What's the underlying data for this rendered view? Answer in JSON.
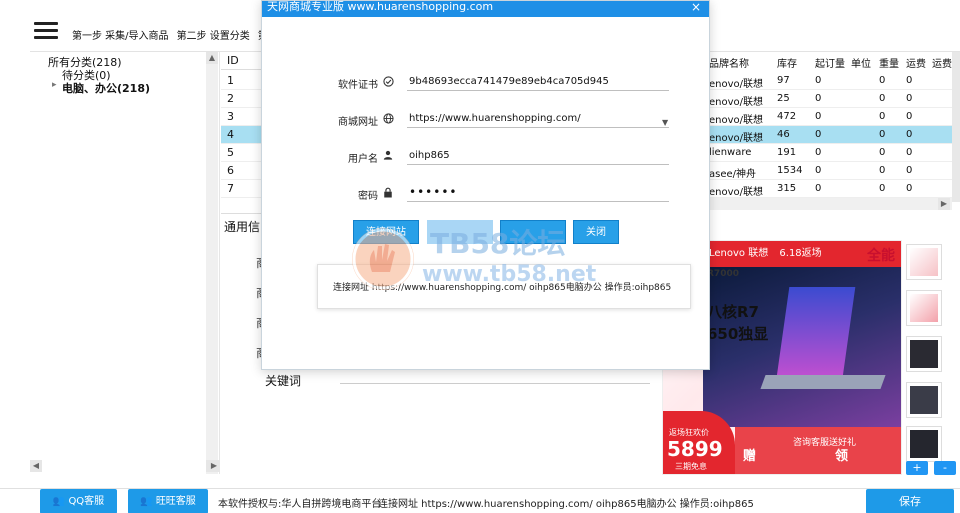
{
  "toolbar": {
    "steps": [
      "第一步 采集/导入商品",
      "第二步 设置分类",
      "第"
    ]
  },
  "tree": {
    "all": "所有分类(218)",
    "pending": "待分类(0)",
    "computers": "电脑、办公(218)"
  },
  "grid": {
    "id_header": "ID",
    "ids": [
      "1",
      "2",
      "3",
      "4",
      "5",
      "6",
      "7"
    ],
    "selected_index": 3,
    "headers": [
      "品牌名称",
      "库存",
      "起订量",
      "单位",
      "重量",
      "运费",
      "运费"
    ],
    "rows": [
      {
        "brand": "enovo/联想",
        "stock": "97",
        "min": "0",
        "weight": "0",
        "ship": "0"
      },
      {
        "brand": "enovo/联想",
        "stock": "25",
        "min": "0",
        "weight": "0",
        "ship": "0"
      },
      {
        "brand": "enovo/联想",
        "stock": "472",
        "min": "0",
        "weight": "0",
        "ship": "0"
      },
      {
        "brand": "enovo/联想",
        "stock": "46",
        "min": "0",
        "weight": "0",
        "ship": "0"
      },
      {
        "brand": "lienware",
        "stock": "191",
        "min": "0",
        "weight": "0",
        "ship": "0"
      },
      {
        "brand": "asee/神舟",
        "stock": "1534",
        "min": "0",
        "weight": "0",
        "ship": "0"
      },
      {
        "brand": "enovo/联想",
        "stock": "315",
        "min": "0",
        "weight": "0",
        "ship": "0"
      }
    ]
  },
  "details": {
    "tab_label": "通用信",
    "cut_char": "商",
    "keyword_label": "关键词"
  },
  "ad": {
    "brand": "Lenovo 联想",
    "promo": "6.18返场",
    "model": "R7000",
    "headline1": "八核R7",
    "headline2": "650独显",
    "price": "5899",
    "price_label": "返场狂欢价",
    "price_sub": "三期免息",
    "gift": "赠",
    "coupon": "领",
    "consult": "咨询客服送好礼",
    "corner": "全能"
  },
  "dialog": {
    "title": "天网商城专业版 www.huarenshopping.com",
    "close": "×",
    "license_label": "软件证书",
    "license_value": "9b48693ecca741479e89eb4ca705d945",
    "url_label": "商城网址",
    "url_value": "https://www.huarenshopping.com/",
    "user_label": "用户名",
    "user_value": "oihp865",
    "pwd_label": "密码",
    "pwd_value": "••••••",
    "btn_connect": "连接网站",
    "btn_close": "关闭",
    "status": "连接网址 https://www.huarenshopping.com/ oihp865电脑办公 操作员:oihp865"
  },
  "watermark": {
    "line1": "TB58论坛",
    "line2": "www.tb58.net"
  },
  "footer": {
    "qq": "QQ客服",
    "ww": "旺旺客服",
    "license": "本软件授权与:华人自拼跨境电商平台",
    "status": "连接网址 https://www.huarenshopping.com/ oihp865电脑办公 操作员:oihp865",
    "save": "保存"
  },
  "buttons": {
    "plus": "+",
    "minus": "-"
  }
}
